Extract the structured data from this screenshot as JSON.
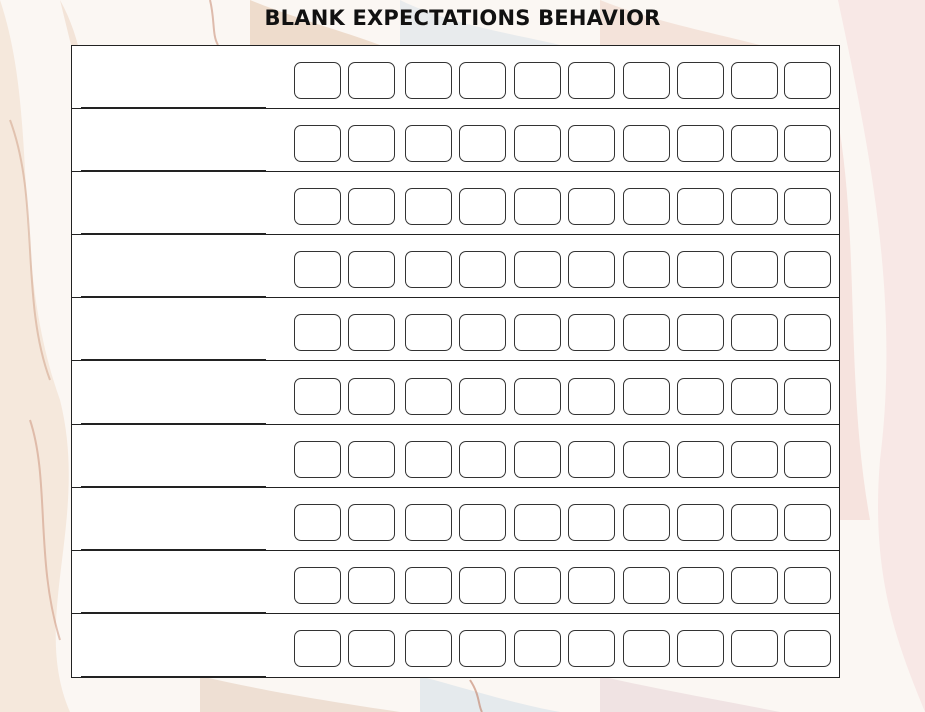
{
  "title": "BLANK EXPECTATIONS BEHAVIOR",
  "rows": 10,
  "boxes_per_row": 10,
  "colors": {
    "background": "#fbf7f3",
    "line": "#222222",
    "box_border": "#333333",
    "title": "#111111"
  },
  "decor": {
    "background_icon": "abstract-marble-swirl-background"
  }
}
